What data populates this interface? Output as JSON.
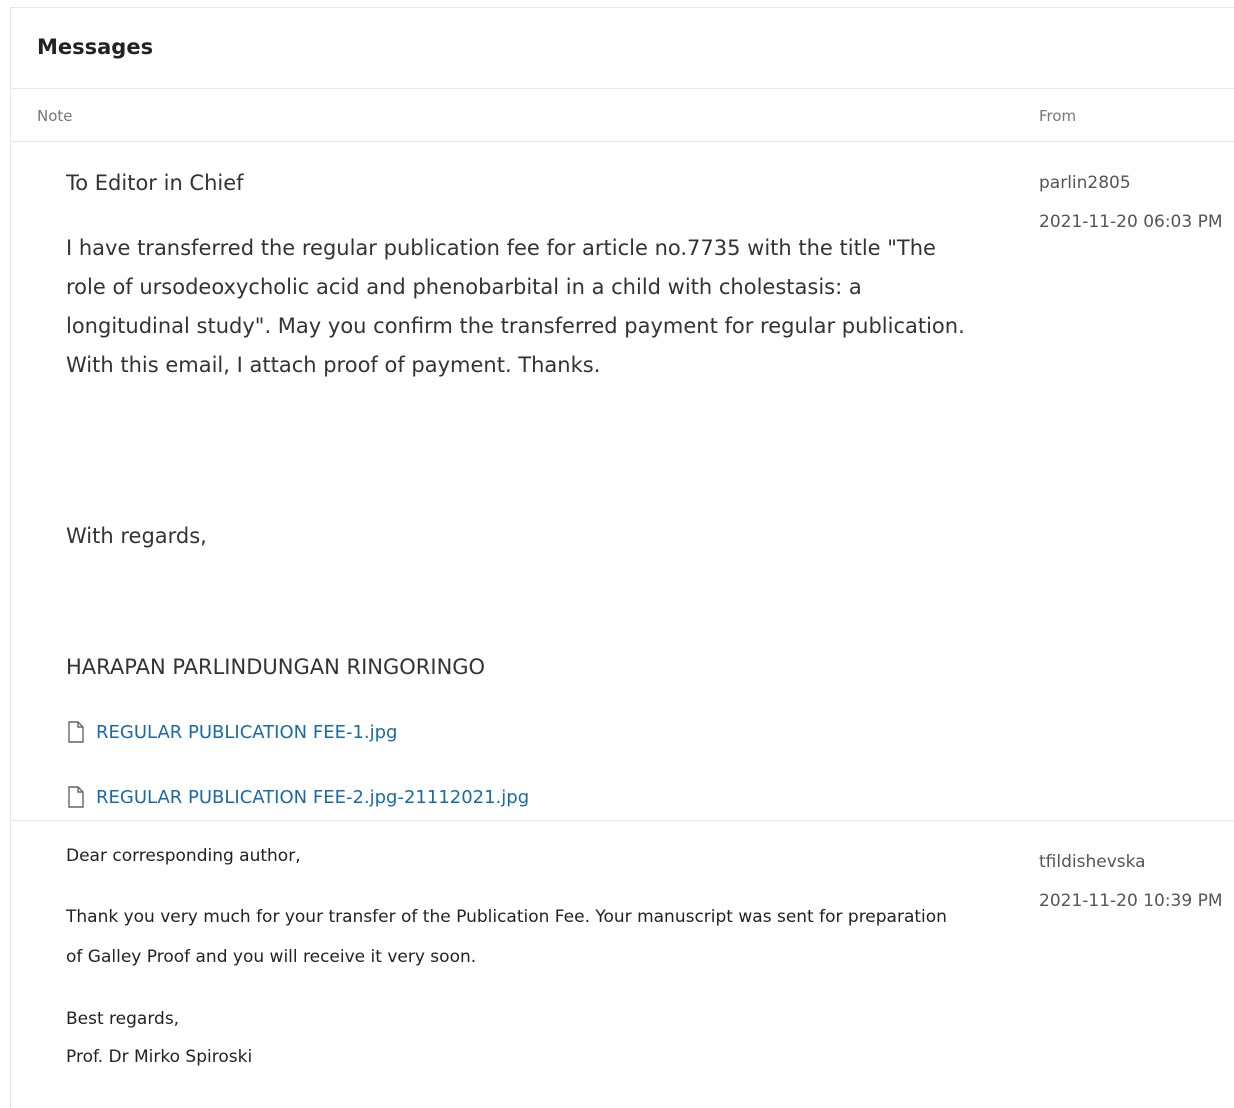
{
  "panel": {
    "title": "Messages",
    "columns": {
      "note": "Note",
      "from": "From"
    }
  },
  "messages": [
    {
      "salutation": "To Editor in Chief",
      "body": "I have transferred the regular publication fee for article no.7735 with the title \"The role of ursodeoxycholic acid and phenobarbital in a child with cholestasis: a longitudinal study\". May you confirm the transferred payment for regular publication. With this email, I attach proof of payment. Thanks.",
      "closing": "With regards,",
      "signature": "HARAPAN PARLINDUNGAN RINGORINGO",
      "attachments": [
        {
          "name": "REGULAR PUBLICATION FEE-1.jpg",
          "icon": "file-icon"
        },
        {
          "name": "REGULAR PUBLICATION FEE-2.jpg-21112021.jpg",
          "icon": "file-icon"
        }
      ],
      "from_user": "parlin2805",
      "from_date": "2021-11-20 06:03 PM"
    },
    {
      "salutation": "Dear corresponding author,",
      "body": "Thank you very much for your transfer of the Publication Fee. Your manuscript was sent for preparation of Galley Proof and you will receive it very soon.",
      "closing": "Best regards,",
      "signature": "Prof. Dr Mirko Spiroski",
      "from_user": "tfildishevska",
      "from_date": "2021-11-20 10:39 PM"
    }
  ],
  "colors": {
    "link": "#1a6aa6",
    "border": "#e6e6e6",
    "muted": "#777777"
  }
}
